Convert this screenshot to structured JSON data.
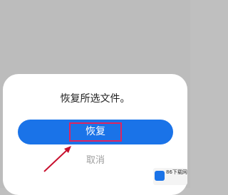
{
  "dialog": {
    "message": "恢复所选文件。",
    "confirm_label": "恢复",
    "cancel_label": "取消"
  },
  "watermark": {
    "site_text": "86下载网"
  },
  "colors": {
    "overlay": "#bcbcbc",
    "primary": "#1a73e8",
    "highlight_box": "#e0245e",
    "annotation_arrow": "#c8102e"
  },
  "icons": {
    "annotation": "arrow-pointer-icon",
    "logo": "site-logo-icon"
  }
}
